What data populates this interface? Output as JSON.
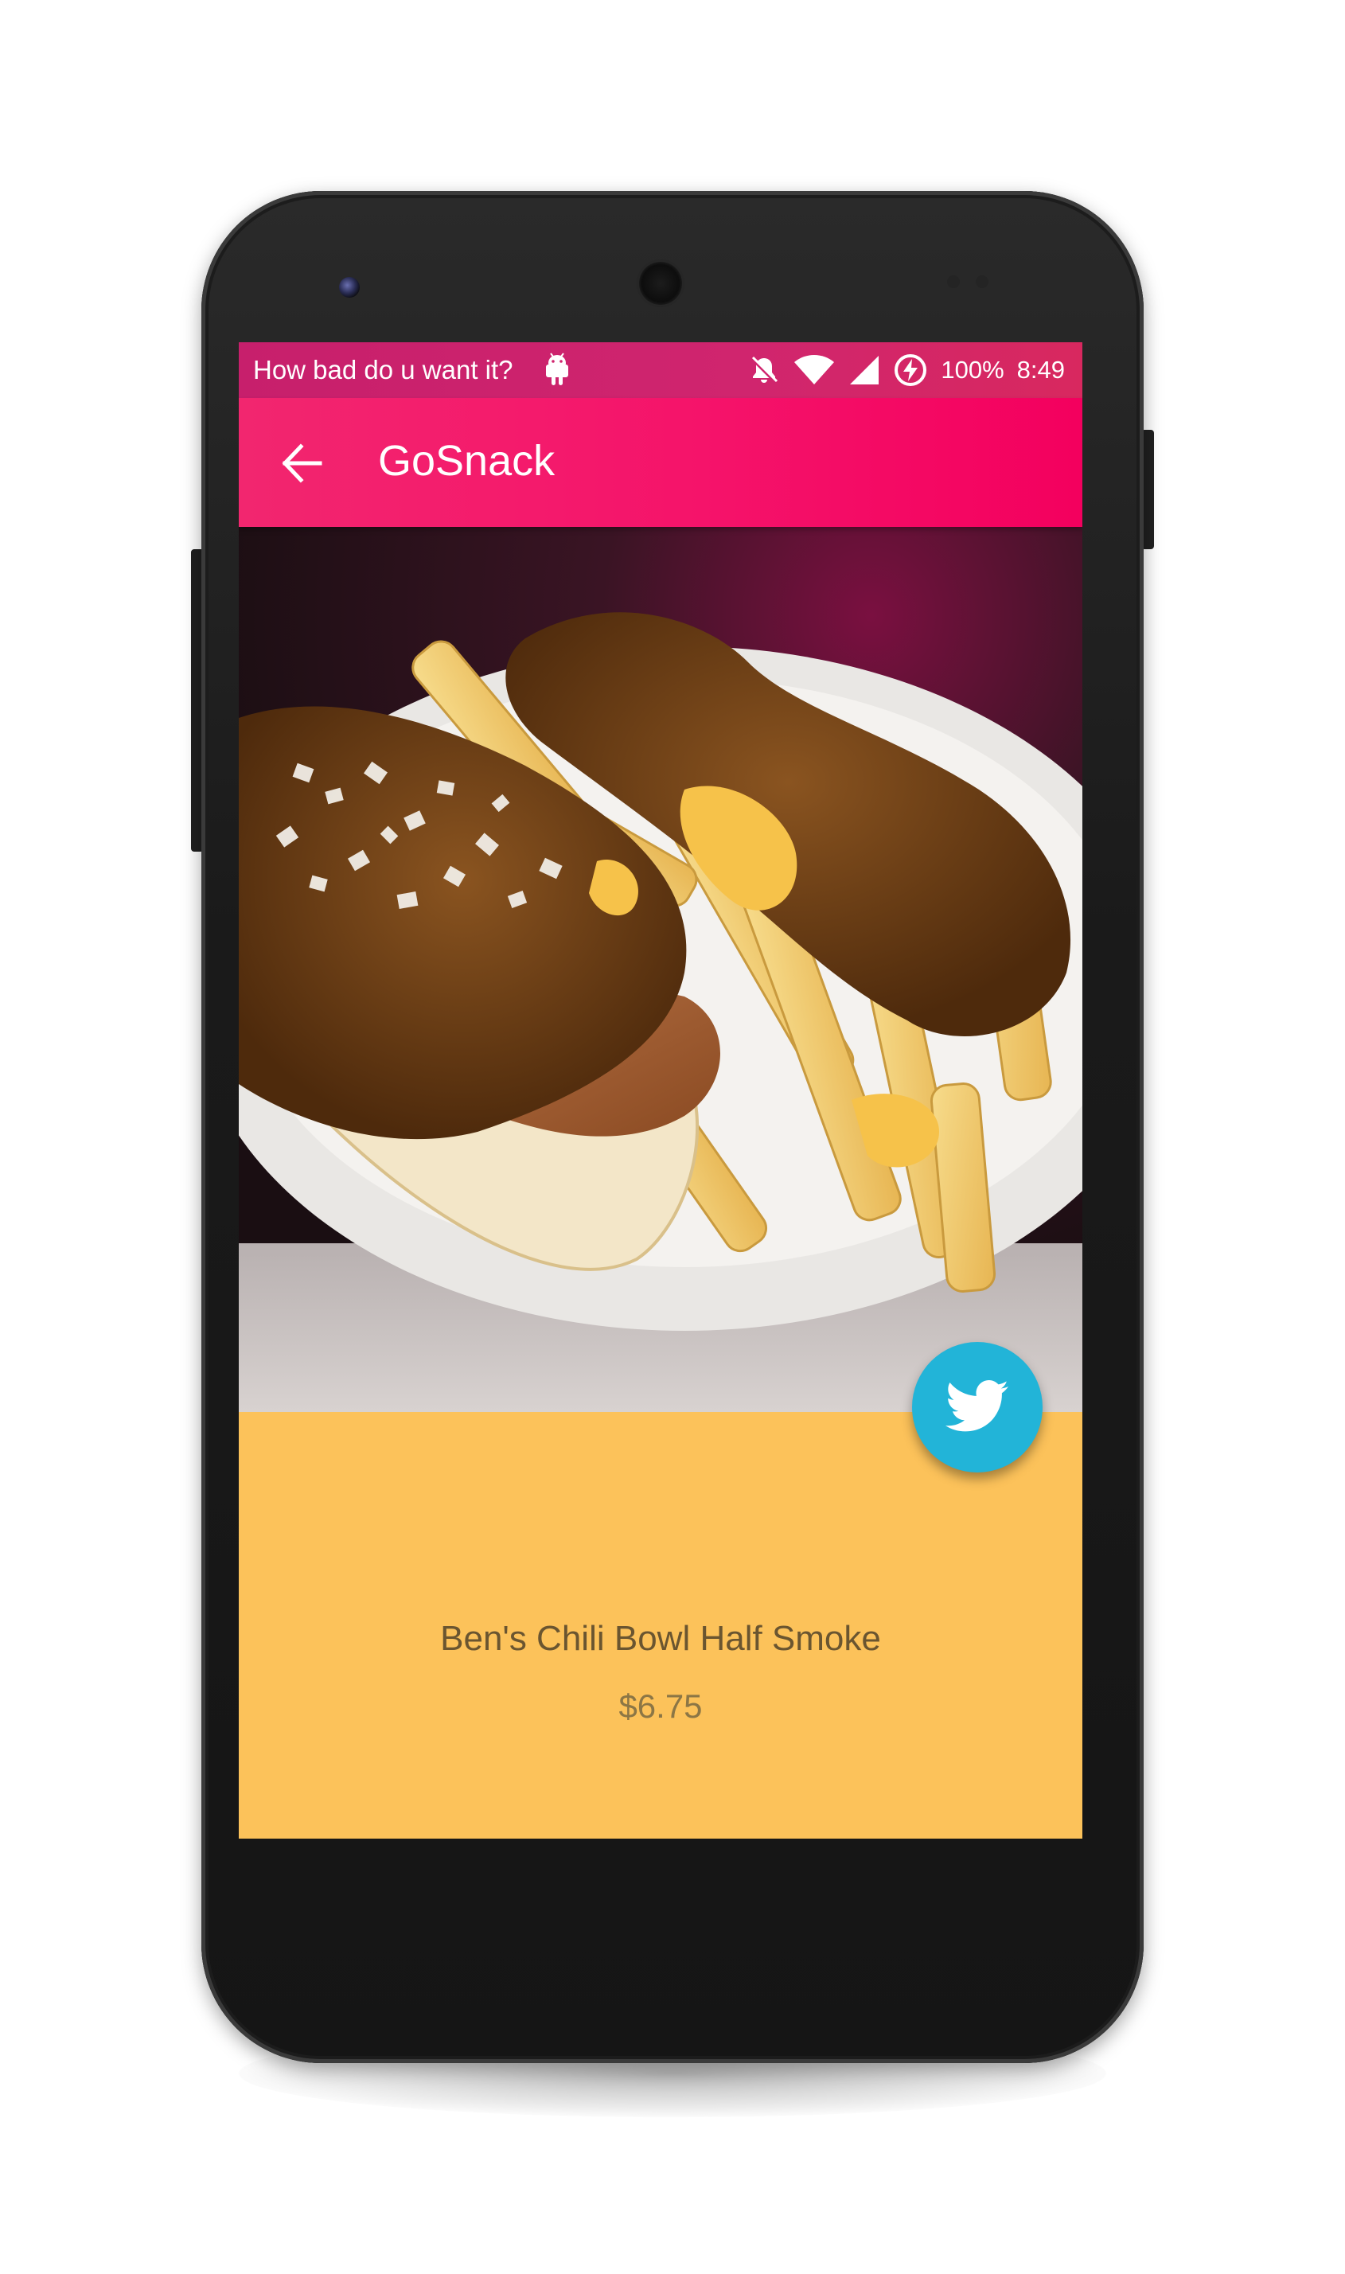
{
  "status_bar": {
    "notification_text": "How bad do u want it?",
    "battery": "100%",
    "time": "8:49",
    "icons": [
      "android-icon",
      "notifications-off-icon",
      "wifi-icon",
      "cell-signal-icon",
      "battery-charging-icon"
    ]
  },
  "toolbar": {
    "title": "GoSnack",
    "back_icon": "arrow-back-icon",
    "color": "#f5136a"
  },
  "item": {
    "name": "Ben's Chili Bowl Half Smoke",
    "price": "$6.75",
    "image": "chili-half-smoke-with-fries-photo"
  },
  "fab": {
    "icon": "twitter-icon",
    "color": "#22b4d8"
  },
  "colors": {
    "status_bar": "#c71f6c",
    "content_background": "#fcc25a"
  }
}
